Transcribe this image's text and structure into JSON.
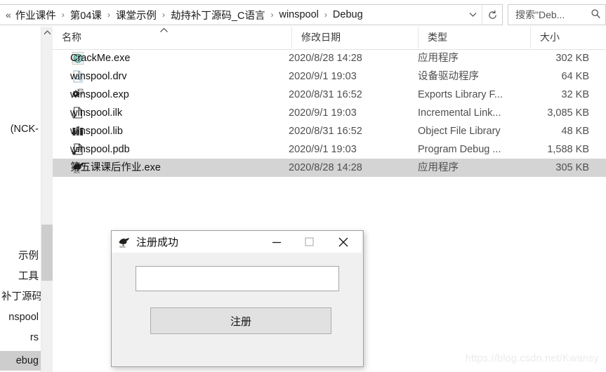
{
  "address_bar": {
    "overflow_chevrons": "«",
    "crumbs": [
      "作业课件",
      "第04课",
      "课堂示例",
      "劫持补丁源码_C语言",
      "winspool",
      "Debug"
    ],
    "separator": "›",
    "dropdown_icon": "chevron-down-icon",
    "refresh_icon": "refresh-icon",
    "refresh_glyph": "↻"
  },
  "search": {
    "placeholder": "搜索\"Deb...",
    "icon": "search-icon"
  },
  "nav_pane": {
    "clipped_text": "(NCK-",
    "items": [
      {
        "label": "示例",
        "selected": false
      },
      {
        "label": "工具",
        "selected": false
      },
      {
        "label": "补丁源码",
        "selected": false
      },
      {
        "label": "nspool",
        "selected": false
      },
      {
        "label": "rs",
        "selected": false
      },
      {
        "label": "ebug",
        "selected": true
      }
    ],
    "scroll_up_glyph": "︿"
  },
  "file_list": {
    "columns": [
      "名称",
      "修改日期",
      "类型",
      "大小"
    ],
    "sort_caret": "︿",
    "rows": [
      {
        "icon": "crackme-app-icon",
        "name": "CrackMe.exe",
        "date": "2020/8/28 14:28",
        "type": "应用程序",
        "size": "302 KB",
        "selected": false
      },
      {
        "icon": "drv-file-icon",
        "name": "winspool.drv",
        "date": "2020/9/1 19:03",
        "type": "设备驱动程序",
        "size": "64 KB",
        "selected": false
      },
      {
        "icon": "exp-file-icon",
        "name": "winspool.exp",
        "date": "2020/8/31 16:52",
        "type": "Exports Library F...",
        "size": "32 KB",
        "selected": false
      },
      {
        "icon": "ilk-file-icon",
        "name": "winspool.ilk",
        "date": "2020/9/1 19:03",
        "type": "Incremental Link...",
        "size": "3,085 KB",
        "selected": false
      },
      {
        "icon": "lib-file-icon",
        "name": "winspool.lib",
        "date": "2020/8/31 16:52",
        "type": "Object File Library",
        "size": "48 KB",
        "selected": false
      },
      {
        "icon": "pdb-file-icon",
        "name": "winspool.pdb",
        "date": "2020/9/1 19:03",
        "type": "Program Debug ...",
        "size": "1,588 KB",
        "selected": false
      },
      {
        "icon": "nck-bird-app-icon",
        "name": "第五课课后作业.exe",
        "date": "2020/8/28 14:28",
        "type": "应用程序",
        "size": "305 KB",
        "selected": true
      }
    ]
  },
  "dialog": {
    "icon": "nck-bird-app-icon",
    "title": "注册成功",
    "minimize_label": "—",
    "maximize_label": "▫",
    "close_label": "✕",
    "input_value": "",
    "input_placeholder": "",
    "button_label": "注册"
  },
  "watermark": {
    "text": "https://blog.csdn.net/Kwansy"
  },
  "colors": {
    "selection": "#d4d4d4",
    "nav_selection": "#cdcdcd",
    "border": "#ccced0",
    "dialog_face": "#f0f0f0",
    "button_face": "#e1e1e1"
  }
}
